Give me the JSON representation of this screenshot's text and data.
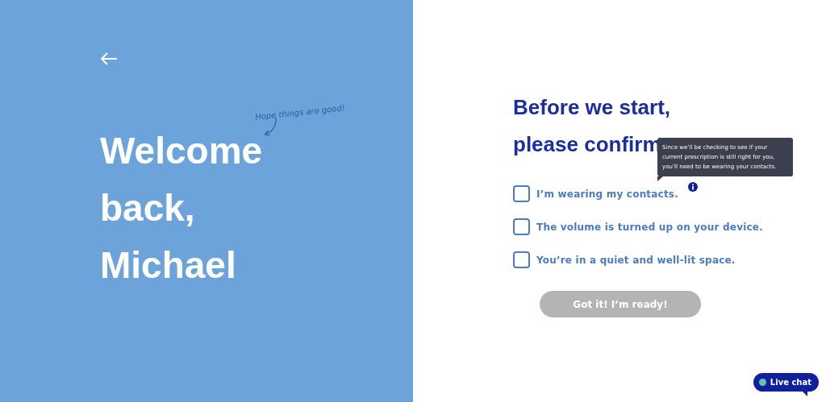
{
  "welcome": {
    "lines": [
      "Welcome",
      "back,",
      "Michael"
    ],
    "note": "Hope things are good!"
  },
  "confirm": {
    "title_lines": [
      "Before we start,",
      "please confirm"
    ],
    "items": [
      {
        "label": "I’m wearing my contacts.",
        "checked": false,
        "info": true
      },
      {
        "label": "The volume is turned up on your device.",
        "checked": false,
        "info": false
      },
      {
        "label": "You’re in a quiet and well-lit space.",
        "checked": false,
        "info": false
      }
    ],
    "tooltip": "Since we’ll be checking to see if your current prescription is still right for you, you’ll need to be wearing your contacts.",
    "button": {
      "label": "Got it! I’m ready!",
      "disabled": true
    }
  },
  "live_chat": "Live chat"
}
